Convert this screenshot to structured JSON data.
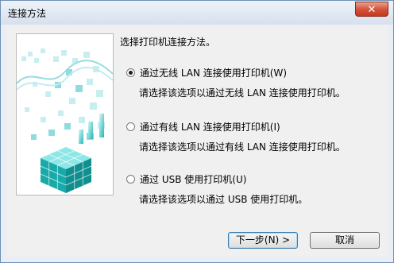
{
  "window": {
    "title": "连接方法",
    "close_glyph": "✕"
  },
  "main": {
    "prompt": "选择打印机连接方法。",
    "options": [
      {
        "label": "通过无线 LAN 连接使用打印机(W)",
        "description": "请选择该选项以通过无线 LAN 连接使用打印机。",
        "selected": true
      },
      {
        "label": "通过有线 LAN 连接使用打印机(I)",
        "description": "请选择该选项以通过有线 LAN 连接使用打印机。",
        "selected": false
      },
      {
        "label": "通过 USB 使用打印机(U)",
        "description": "请选择该选项以通过 USB 使用打印机。",
        "selected": false
      }
    ]
  },
  "buttons": {
    "next": "下一步(N) >",
    "cancel": "取消"
  },
  "colors": {
    "accent": "#1aa7a7",
    "cube_light": "#7fe0e0",
    "cube_dark": "#0f8f8f"
  }
}
